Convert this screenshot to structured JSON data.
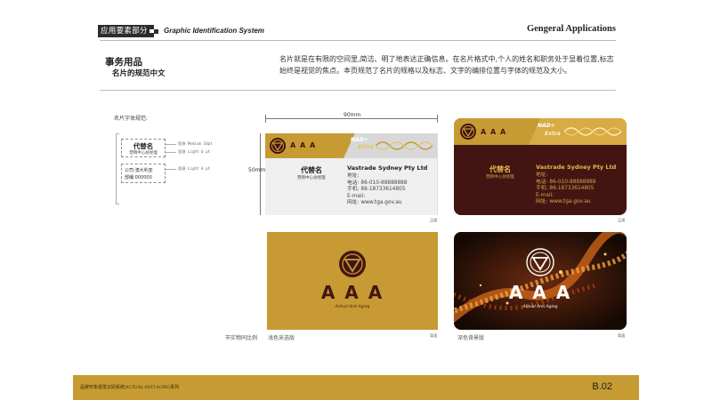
{
  "header": {
    "section_tag": "应用要素部分",
    "system_title": "Graphic Identification System",
    "right_title": "Gengeral Applications"
  },
  "section": {
    "title": "事务用品",
    "subtitle": "名片的规范中文",
    "description": "名片就是在有限的空间里,简洁、明了地表达正确信息。在名片格式中,个人的姓名和职务处于显着位置,标志始终是视觉的焦点。本页规范了名片的规格以及标志、文字的编排位置与字体的规范及大小。"
  },
  "font_spec": {
    "label": "名片字体规范:",
    "sample_name": "代替名",
    "sample_title": "营销中心总经理",
    "sample_company": "公司:澳大利亚",
    "sample_dept": "部编:000000",
    "spec1": "思源 Medium   10pt",
    "spec2": "思源 Light    6 pt",
    "spec3": "思源 Light    6 pt"
  },
  "dimensions": {
    "width": "90mm",
    "height": "50mm"
  },
  "card": {
    "name": "代替名",
    "title": "营销中心总经理",
    "company": "Vastrade Sydney Pty Ltd",
    "address": "地址:",
    "phone": "电话: 86-010-88888888",
    "mobile": "手机: 86-18733614805",
    "email": "E-mail:",
    "web": "网址: www.tga.gov.au",
    "nad": "NAD+",
    "extra": "Extra",
    "logo_text": "A A A",
    "logo_small": "Actual Anti Aging",
    "seal_text": "ACTUAL ANTI AGING"
  },
  "notes": {
    "front": "正面",
    "back": "背面"
  },
  "labels": {
    "scale": "市实物同比例",
    "light": "浅色采选版",
    "dark": "深色背景版"
  },
  "footer": {
    "text": "品牌形象视觉识别系统|ACTUAL ANTI AGING系列",
    "page": "B.02"
  },
  "colors": {
    "gold": "#c89a33",
    "maroon": "#431512",
    "dark": "#2c2c2c"
  }
}
